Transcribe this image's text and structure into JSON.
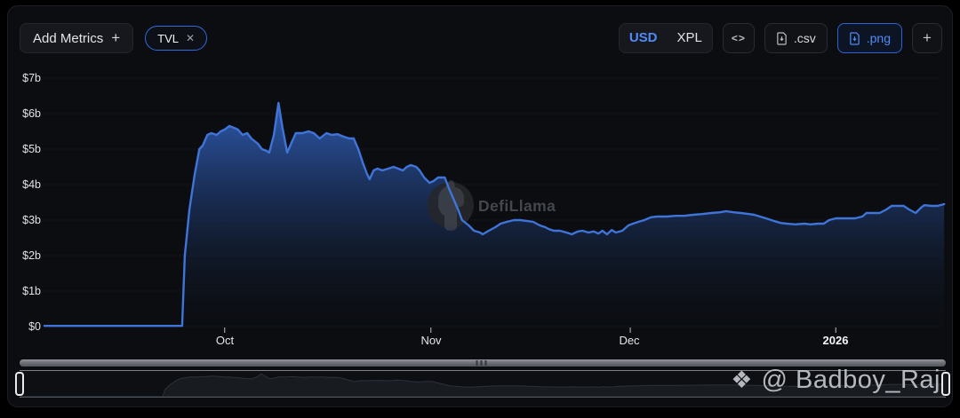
{
  "toolbar": {
    "add_metrics_label": "Add Metrics",
    "add_metrics_plus": "+",
    "metric_pill": {
      "label": "TVL",
      "close": "✕"
    },
    "currency_toggle": {
      "options": [
        "USD",
        "XPL"
      ],
      "selected": "USD"
    },
    "code_button_label": "<>",
    "csv_button_label": ".csv",
    "png_button_label": ".png",
    "add_chart_button_label": "+"
  },
  "watermark": {
    "logo_text": "DefiLlama"
  },
  "credit_overlay": {
    "icon": "❖",
    "text": "@ Badboy_Raj"
  },
  "colors": {
    "accent_blue": "#4f8cf7",
    "line_blue": "#3f74d9",
    "pill_border": "#2e6ae0",
    "card_bg": "#0b0d11",
    "page_bg": "#000000"
  },
  "chart_data": {
    "type": "area",
    "title": "TVL",
    "currency": "USD",
    "y_unit": "billions USD",
    "ylim": [
      0,
      7
    ],
    "grid": "dotted-horizontal",
    "x_unit": "days since 2025-09-04",
    "y_ticks": [
      "$7b",
      "$6b",
      "$5b",
      "$4b",
      "$3b",
      "$2b",
      "$1b",
      "$0"
    ],
    "x_ticks": [
      {
        "label": "Oct",
        "day": 27.1
      },
      {
        "label": "Nov",
        "day": 58.1
      },
      {
        "label": "Dec",
        "day": 88.1
      },
      {
        "label": "2026",
        "day": 119
      }
    ],
    "series": [
      {
        "name": "TVL",
        "color": "#3f74d9",
        "points": [
          [
            0,
            0.02
          ],
          [
            20.7,
            0.02
          ],
          [
            21.1,
            2.0
          ],
          [
            21.8,
            3.3
          ],
          [
            22.6,
            4.3
          ],
          [
            23.3,
            5.0
          ],
          [
            23.8,
            5.1
          ],
          [
            24.5,
            5.4
          ],
          [
            25.1,
            5.45
          ],
          [
            25.9,
            5.4
          ],
          [
            26.5,
            5.5
          ],
          [
            27.1,
            5.55
          ],
          [
            27.8,
            5.65
          ],
          [
            28.5,
            5.6
          ],
          [
            29.1,
            5.55
          ],
          [
            29.8,
            5.4
          ],
          [
            30.5,
            5.45
          ],
          [
            31.1,
            5.3
          ],
          [
            32.1,
            5.15
          ],
          [
            32.7,
            5.0
          ],
          [
            33.4,
            4.95
          ],
          [
            33.8,
            4.9
          ],
          [
            34.5,
            5.4
          ],
          [
            35.2,
            6.3
          ],
          [
            35.8,
            5.6
          ],
          [
            36.5,
            4.9
          ],
          [
            37.2,
            5.2
          ],
          [
            37.8,
            5.45
          ],
          [
            38.8,
            5.45
          ],
          [
            39.7,
            5.5
          ],
          [
            40.5,
            5.45
          ],
          [
            41.4,
            5.3
          ],
          [
            42.4,
            5.45
          ],
          [
            43.2,
            5.4
          ],
          [
            44.1,
            5.42
          ],
          [
            45,
            5.35
          ],
          [
            45.8,
            5.3
          ],
          [
            46.5,
            5.3
          ],
          [
            47.2,
            5.0
          ],
          [
            47.9,
            4.6
          ],
          [
            48.5,
            4.3
          ],
          [
            48.9,
            4.15
          ],
          [
            49.5,
            4.4
          ],
          [
            50.1,
            4.45
          ],
          [
            50.8,
            4.4
          ],
          [
            51.7,
            4.45
          ],
          [
            52.5,
            4.5
          ],
          [
            53.2,
            4.45
          ],
          [
            53.9,
            4.4
          ],
          [
            54.5,
            4.5
          ],
          [
            55.1,
            4.55
          ],
          [
            55.9,
            4.5
          ],
          [
            56.4,
            4.4
          ],
          [
            57.1,
            4.2
          ],
          [
            57.9,
            4.05
          ],
          [
            58.5,
            4.1
          ],
          [
            59.2,
            4.2
          ],
          [
            60.2,
            4.2
          ],
          [
            60.8,
            3.9
          ],
          [
            61.5,
            3.6
          ],
          [
            62.2,
            3.3
          ],
          [
            62.8,
            3.0
          ],
          [
            63.8,
            2.85
          ],
          [
            64.6,
            2.7
          ],
          [
            65.5,
            2.65
          ],
          [
            65.9,
            2.6
          ],
          [
            66.8,
            2.7
          ],
          [
            67.8,
            2.8
          ],
          [
            68.6,
            2.9
          ],
          [
            69.5,
            2.95
          ],
          [
            70.6,
            3.0
          ],
          [
            71.5,
            3.0
          ],
          [
            72.4,
            2.98
          ],
          [
            73.5,
            2.95
          ],
          [
            74.5,
            2.85
          ],
          [
            75.3,
            2.8
          ],
          [
            75.8,
            2.75
          ],
          [
            76.6,
            2.7
          ],
          [
            77.5,
            2.7
          ],
          [
            78.5,
            2.65
          ],
          [
            79.3,
            2.6
          ],
          [
            80.2,
            2.68
          ],
          [
            80.9,
            2.7
          ],
          [
            81.8,
            2.65
          ],
          [
            82.6,
            2.68
          ],
          [
            83.3,
            2.62
          ],
          [
            83.9,
            2.7
          ],
          [
            84.6,
            2.6
          ],
          [
            85.3,
            2.72
          ],
          [
            85.9,
            2.65
          ],
          [
            86.9,
            2.7
          ],
          [
            87.8,
            2.85
          ],
          [
            88.5,
            2.9
          ],
          [
            89.3,
            2.95
          ],
          [
            90.2,
            3.0
          ],
          [
            91.2,
            3.08
          ],
          [
            92.2,
            3.1
          ],
          [
            93.6,
            3.1
          ],
          [
            94.9,
            3.12
          ],
          [
            96.2,
            3.12
          ],
          [
            97.6,
            3.15
          ],
          [
            98.9,
            3.17
          ],
          [
            100.3,
            3.2
          ],
          [
            101.6,
            3.22
          ],
          [
            102.5,
            3.25
          ],
          [
            103.6,
            3.22
          ],
          [
            104.7,
            3.2
          ],
          [
            105.6,
            3.18
          ],
          [
            106.7,
            3.15
          ],
          [
            107.6,
            3.1
          ],
          [
            108.5,
            3.05
          ],
          [
            109.6,
            2.98
          ],
          [
            110.7,
            2.92
          ],
          [
            111.6,
            2.9
          ],
          [
            112.9,
            2.88
          ],
          [
            114.3,
            2.9
          ],
          [
            115.2,
            2.88
          ],
          [
            116.3,
            2.9
          ],
          [
            117.2,
            2.9
          ],
          [
            118,
            3.0
          ],
          [
            119,
            3.05
          ],
          [
            119.9,
            3.05
          ],
          [
            121,
            3.05
          ],
          [
            121.9,
            3.05
          ],
          [
            123,
            3.1
          ],
          [
            123.6,
            3.2
          ],
          [
            124.7,
            3.2
          ],
          [
            125.6,
            3.2
          ],
          [
            126.6,
            3.3
          ],
          [
            127.4,
            3.4
          ],
          [
            128.3,
            3.4
          ],
          [
            129.2,
            3.4
          ],
          [
            130,
            3.3
          ],
          [
            131,
            3.2
          ],
          [
            131.8,
            3.35
          ],
          [
            132.3,
            3.42
          ],
          [
            133.4,
            3.4
          ],
          [
            134.3,
            3.4
          ],
          [
            135.3,
            3.45
          ]
        ]
      }
    ]
  }
}
